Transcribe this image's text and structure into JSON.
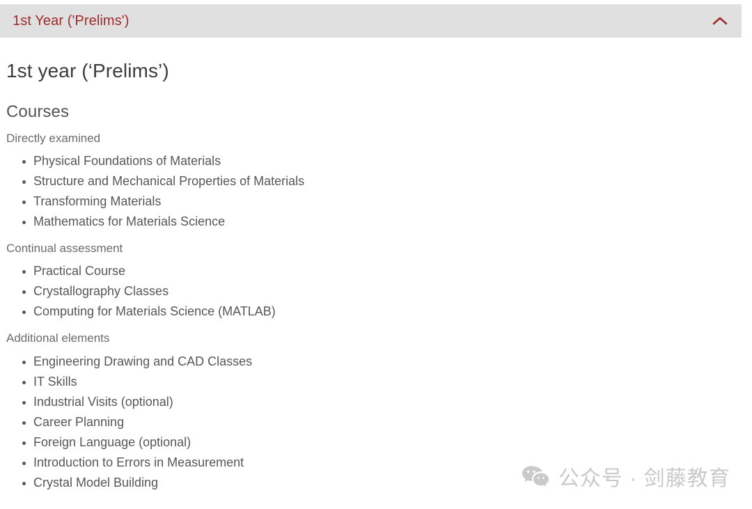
{
  "accordion": {
    "title": "1st Year ('Prelims')",
    "toggle_icon": "chevron-up-icon",
    "expanded": true,
    "header_bg": "#e0e0e0",
    "title_color": "#9e2a2a"
  },
  "page": {
    "title": "1st year (‘Prelims’)",
    "section_title": "Courses",
    "groups": [
      {
        "label": "Directly examined",
        "items": [
          "Physical Foundations of Materials",
          "Structure and Mechanical Properties of Materials",
          "Transforming Materials",
          "Mathematics for Materials Science"
        ]
      },
      {
        "label": "Continual assessment",
        "items": [
          "Practical Course",
          "Crystallography Classes",
          "Computing for Materials Science (MATLAB)"
        ]
      },
      {
        "label": "Additional elements",
        "items": [
          "Engineering Drawing and CAD Classes",
          "IT Skills",
          "Industrial Visits (optional)",
          "Career Planning",
          "Foreign Language (optional)",
          "Introduction to Errors in Measurement",
          "Crystal Model Building"
        ]
      }
    ]
  },
  "watermark": {
    "icon": "wechat-icon",
    "text": "公众号 · 剑藤教育",
    "color": "#c9c9c9"
  }
}
